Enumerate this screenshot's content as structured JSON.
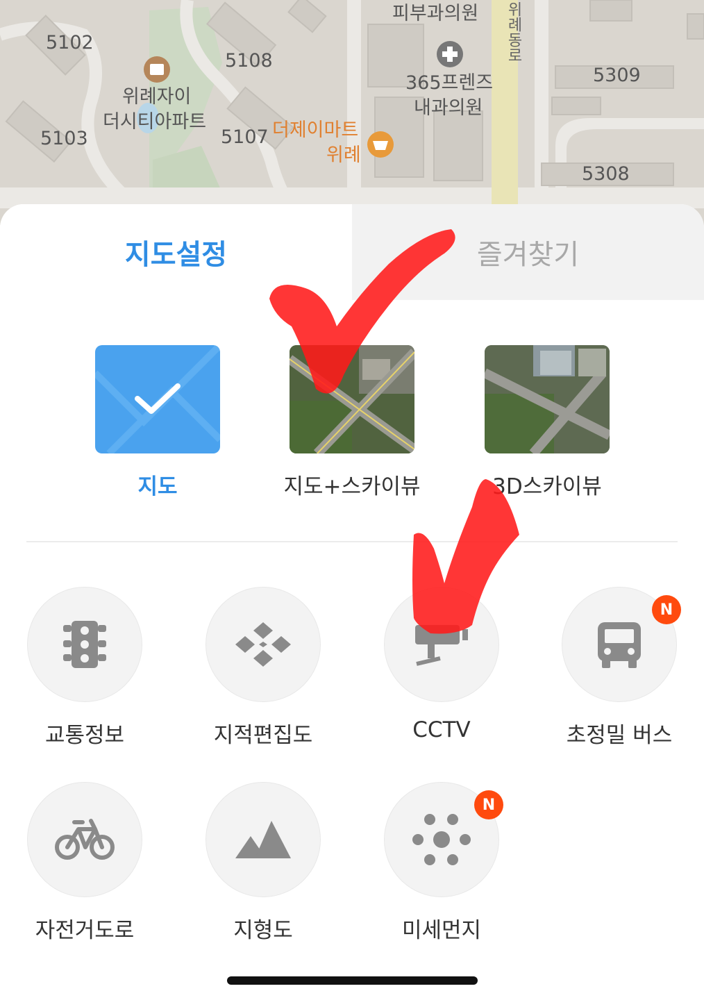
{
  "map": {
    "labels": {
      "b5102": "5102",
      "b5108": "5108",
      "b5103": "5103",
      "b5107": "5107",
      "b5309": "5309",
      "b5308": "5308",
      "apt_line1": "위례자이",
      "apt_line2": "더시티아파트",
      "clinic_top": "피부과의원",
      "clinic_line1": "365프렌즈",
      "clinic_line2": "내과의원",
      "mart_line1": "더제이마트",
      "mart_line2": "위례",
      "road": "위례동로"
    },
    "icons": [
      "building-icon",
      "hospital-icon",
      "shopping-basket-icon"
    ]
  },
  "tabs": {
    "map_settings": "지도설정",
    "favorites": "즐겨찾기",
    "active": "map_settings"
  },
  "map_modes": {
    "map": "지도",
    "map_skyview": "지도+스카이뷰",
    "skyview_3d": "3D스카이뷰",
    "selected": "map"
  },
  "layers": {
    "traffic": {
      "label": "교통정보",
      "icon": "traffic-light-icon"
    },
    "cadastral": {
      "label": "지적편집도",
      "icon": "cadastral-icon"
    },
    "cctv": {
      "label": "CCTV",
      "icon": "cctv-camera-icon"
    },
    "precise_bus": {
      "label": "초정밀 버스",
      "icon": "bus-icon",
      "badge": "N"
    },
    "bike_road": {
      "label": "자전거도로",
      "icon": "bicycle-icon"
    },
    "terrain": {
      "label": "지형도",
      "icon": "mountain-icon"
    },
    "fine_dust": {
      "label": "미세먼지",
      "icon": "dust-icon",
      "badge": "N"
    }
  },
  "colors": {
    "accent": "#2f8de4",
    "badge": "#ff4a0e",
    "annotation": "#ff1a1a",
    "icon_gray": "#8a8a8a"
  }
}
